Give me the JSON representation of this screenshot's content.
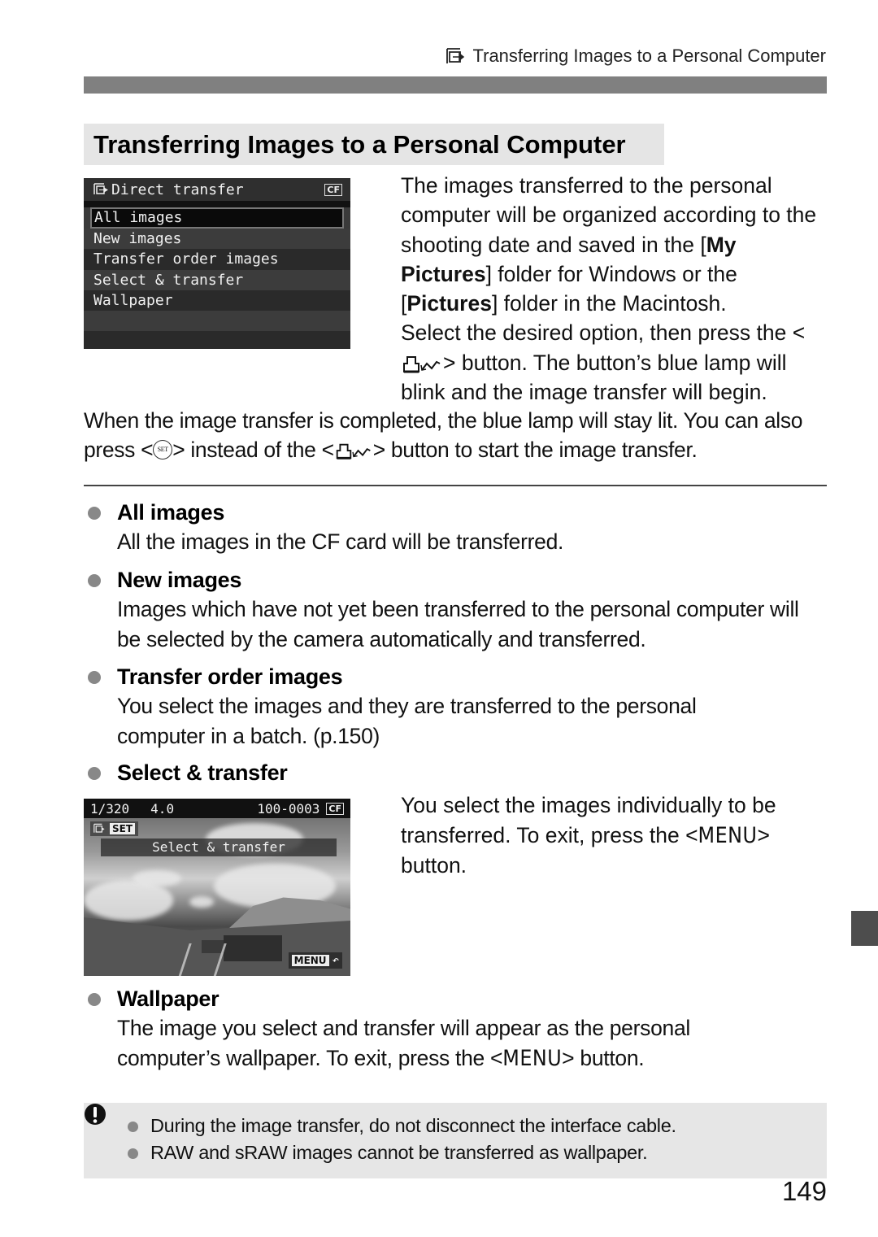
{
  "running_head": {
    "icon": "direct-transfer-icon",
    "text": "Transferring Images to a Personal Computer"
  },
  "section_title": "Transferring Images to a Personal Computer",
  "menu_screen": {
    "title": "Direct transfer",
    "title_icon": "direct-transfer-icon",
    "card_badge": "CF",
    "items": [
      {
        "label": "All images",
        "selected": true
      },
      {
        "label": "New images",
        "selected": false
      },
      {
        "label": "Transfer order images",
        "selected": false
      },
      {
        "label": "Select & transfer",
        "selected": false
      },
      {
        "label": "Wallpaper",
        "selected": false
      }
    ]
  },
  "intro": {
    "p1_a": "The images transferred to the personal computer will be organized according to the shooting date and saved in the [",
    "p1_bold1": "My Pictures",
    "p1_b": "] folder for Windows or the [",
    "p1_bold2": "Pictures",
    "p1_c": "] folder in the Macintosh.",
    "p2_a": "Select the desired option, then press the <",
    "p2_b": "> button. The button’s blue lamp will blink and the image transfer will begin.",
    "p3_a": "When the image transfer is completed, the blue lamp will stay lit. You can also press <",
    "p3_set": "SET",
    "p3_b": "> instead of the <",
    "p3_c": "> button to start the image transfer."
  },
  "options": [
    {
      "title": "All images",
      "desc": "All the images in the CF card will be transferred."
    },
    {
      "title": "New images",
      "desc": "Images which have not yet been transferred to the personal computer will be selected by the camera automatically and transferred."
    },
    {
      "title": "Transfer order images",
      "desc": "You select the images and they are transferred to the personal computer in a batch. (p.150)"
    },
    {
      "title": "Select & transfer",
      "desc": ""
    },
    {
      "title": "Wallpaper",
      "desc_a": "The image you select and transfer will appear as the personal computer’s wallpaper. To exit, press the <",
      "desc_menu": "MENU",
      "desc_b": "> button."
    }
  ],
  "photo_screen": {
    "shutter": "1/320",
    "aperture": "4.0",
    "file_number": "100-0003",
    "card_badge": "CF",
    "set_tag": "SET",
    "banner": "Select & transfer",
    "menu_tag": "MENU",
    "return_icon": "return-arrow-icon"
  },
  "select_transfer_text": {
    "a": "You select the images individually to be transferred. To exit, press the <",
    "menu": "MENU",
    "b": "> button."
  },
  "caution": {
    "icon": "caution-icon",
    "items": [
      "During the image transfer, do not disconnect the interface cable.",
      "RAW and sRAW images cannot be transferred as wallpaper."
    ]
  },
  "page_number": "149"
}
